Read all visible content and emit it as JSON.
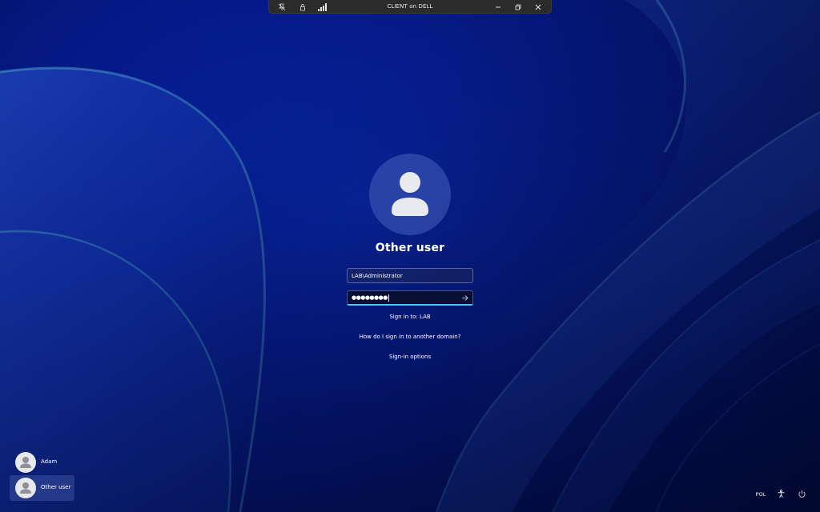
{
  "connection_bar": {
    "title": "CLIENT on DELL",
    "icons": [
      "pin-off-icon",
      "lock-icon",
      "signal-bars-icon"
    ],
    "controls": [
      "minimize-icon",
      "restore-icon",
      "close-icon"
    ]
  },
  "login": {
    "user_title": "Other user",
    "username_value": "LAB\\Administrator",
    "password_mask": "●●●●●●●●",
    "sign_in_to": "Sign in to: LAB",
    "domain_help_link": "How do I sign in to another domain?",
    "sign_in_options_link": "Sign-in options"
  },
  "user_list": [
    {
      "label": "Adam",
      "selected": false
    },
    {
      "label": "Other user",
      "selected": true
    }
  ],
  "tray": {
    "language": "POL",
    "icons": [
      "accessibility-icon",
      "power-icon"
    ]
  },
  "colors": {
    "accent": "#4cc2ff",
    "wallpaper_base": "#0722a6"
  }
}
